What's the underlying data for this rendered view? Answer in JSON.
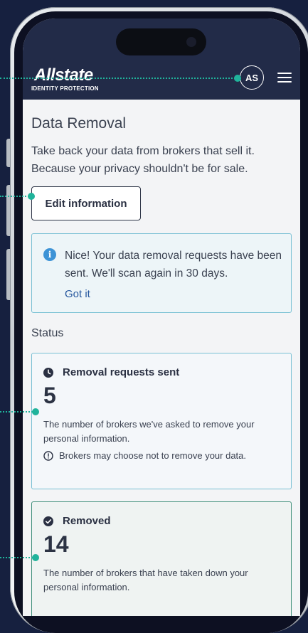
{
  "header": {
    "logo_word": "Allstate",
    "logo_sub": "IDENTITY PROTECTION",
    "avatar_initials": "AS",
    "menu_icon": "hamburger-menu-icon"
  },
  "page": {
    "title": "Data Removal",
    "description": "Take back your data from brokers that sell it. Because your privacy shouldn't be for sale.",
    "edit_button": "Edit information"
  },
  "notice": {
    "icon": "info-icon",
    "text": "Nice! Your data removal requests have been sent. We'll scan again in 30 days.",
    "action": "Got it"
  },
  "status": {
    "heading": "Status",
    "cards": [
      {
        "icon": "clock-icon",
        "title": "Removal requests sent",
        "count": "5",
        "description": "The number of brokers we've asked to remove your personal information.",
        "warning_icon": "alert-circle-icon",
        "warning": "Brokers may choose not to remove your data."
      },
      {
        "icon": "check-circle-icon",
        "title": "Removed",
        "count": "14",
        "description": "The number of brokers that have taken down your personal information."
      }
    ]
  },
  "colors": {
    "header_bg": "#222b48",
    "page_bg": "#16203f",
    "accent_teal": "#20b39b",
    "info_blue": "#3d93d6",
    "link_blue": "#26579e"
  }
}
